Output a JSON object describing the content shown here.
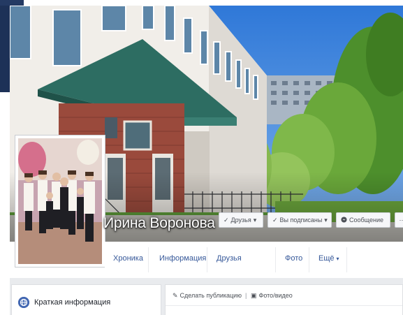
{
  "profile": {
    "name": "Ирина Воронова"
  },
  "actions": {
    "friends_label": "Друзья",
    "follow_label": "Вы подписаны",
    "message_label": "Сообщение",
    "more_label": "···",
    "check_glyph": "✓",
    "caret_glyph": "▾"
  },
  "tabs": [
    {
      "label": "Хроника"
    },
    {
      "label": "Информация"
    },
    {
      "label": "Друзья"
    },
    {
      "label": "Фото"
    },
    {
      "label": "Ещё"
    }
  ],
  "intro": {
    "title": "Краткая информация",
    "icon": "globe-icon"
  },
  "composer": {
    "status_label": "Сделать публикацию",
    "photo_label": "Фото/видео",
    "status_icon": "pencil-icon",
    "photo_icon": "camera-icon"
  },
  "colors": {
    "facebook_blue": "#4267b2",
    "link_blue": "#365899",
    "page_grey": "#e9ebee",
    "dark_tab": "#243a63"
  }
}
